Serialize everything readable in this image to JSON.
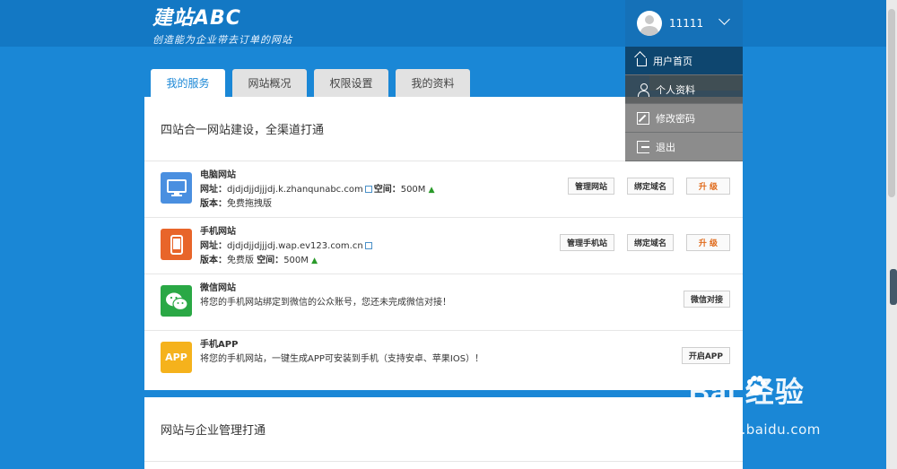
{
  "logo": {
    "main": "建站ABC",
    "slogan": "创造能为企业带去订单的网站"
  },
  "user": {
    "name": "11111"
  },
  "dropdown": [
    {
      "label": "用户首页"
    },
    {
      "label": "个人资料"
    },
    {
      "label": "修改密码"
    },
    {
      "label": "退出"
    }
  ],
  "tabs": [
    {
      "label": "我的服务"
    },
    {
      "label": "网站概况"
    },
    {
      "label": "权限设置"
    },
    {
      "label": "我的资料"
    }
  ],
  "panel1": {
    "title": "四站合一网站建设，全渠道打通",
    "services": [
      {
        "name": "电脑网站",
        "url_label": "网址：",
        "url": "djdjdjjdjjjdj.k.zhanqunabc.com",
        "space_label": "空间：",
        "space": "500M",
        "version_label": "版本：",
        "version": "免费拖拽版",
        "buttons": [
          "管理网站",
          "绑定域名",
          "升 级"
        ]
      },
      {
        "name": "手机网站",
        "url_label": "网址：",
        "url": "djdjdjjdjjjdj.wap.ev123.com.cn",
        "version_label": "版本：",
        "version": "免费版",
        "space_label": "空间：",
        "space": "500M",
        "buttons": [
          "管理手机站",
          "绑定域名",
          "升 级"
        ]
      },
      {
        "name": "微信网站",
        "desc": "将您的手机网站绑定到微信的公众账号，您还未完成微信对接！",
        "buttons": [
          "微信对接"
        ]
      },
      {
        "name": "手机APP",
        "icon_text": "APP",
        "desc": "将您的手机网站，一键生成APP可安装到手机（支持安卓、苹果IOS）！",
        "buttons": [
          "开启APP"
        ]
      }
    ]
  },
  "panel2": {
    "title": "网站与企业管理打通"
  },
  "watermark": {
    "main": "Bai 经验",
    "sub": "jingyan.baidu.com"
  },
  "colors": {
    "background": "#1a87d6",
    "header": "#1378c4",
    "accent": "#1a87d6",
    "upgrade": "#e06a1a"
  }
}
